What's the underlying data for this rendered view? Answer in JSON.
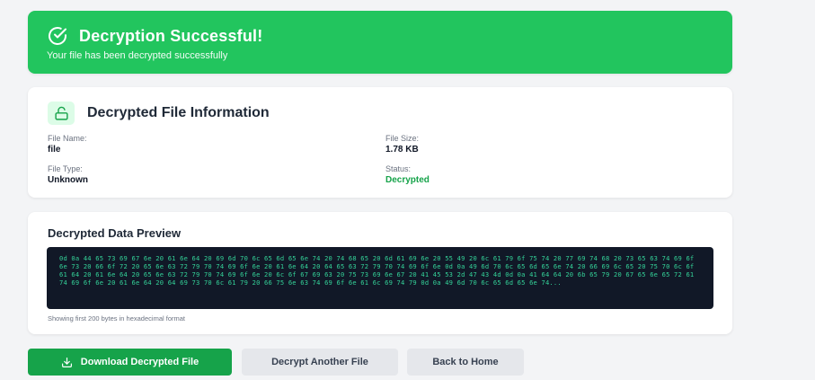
{
  "banner": {
    "title": "Decryption Successful!",
    "subtitle": "Your file has been decrypted successfully",
    "icon": "check-circle-icon",
    "color": "#22c55e"
  },
  "file_info": {
    "heading": "Decrypted File Information",
    "icon": "unlock-icon",
    "name_label": "File Name:",
    "name_value": "file",
    "type_label": "File Type:",
    "type_value": "Unknown",
    "size_label": "File Size:",
    "size_value": "1.78 KB",
    "status_label": "Status:",
    "status_value": "Decrypted",
    "status_color": "#16a34a"
  },
  "preview": {
    "heading": "Decrypted Data Preview",
    "hex": "0d 0a 44 65 73 69 67 6e 20 61 6e 64 20 69 6d 70 6c 65 6d 65 6e 74 20 74 68 65 20 6d 61 69 6e 20 55 49 20 6c 61 79 6f 75 74 20 77 69 74 68 20 73 65 63 74 69 6f 6e 73 20 66 6f 72 20 65 6e 63 72 79 70 74 69 6f 6e 20 61 6e 64 20 64 65 63 72 79 70 74 69 6f 6e 0d 0a 49 6d 70 6c 65 6d 65 6e 74 20 66 69 6c 65 20 75 70 6c 6f 61 64 20 61 6e 64 20 65 6e 63 72 79 70 74 69 6f 6e 20 6c 6f 67 69 63 20 75 73 69 6e 67 20 41 45 53 2d 47 43 4d 0d 0a 41 64 64 20 6b 65 79 20 67 65 6e 65 72 61 74 69 6f 6e 20 61 6e 64 20 64 69 73 70 6c 61 79 20 66 75 6e 63 74 69 6f 6e 61 6c 69 74 79 0d 0a 49 6d 70 6c 65 6d 65 6e 74...",
    "note": "Showing first 200 bytes in hexadecimal format"
  },
  "actions": {
    "download_label": "Download Decrypted File",
    "download_icon": "download-icon",
    "decrypt_another_label": "Decrypt Another File",
    "home_label": "Back to Home"
  }
}
